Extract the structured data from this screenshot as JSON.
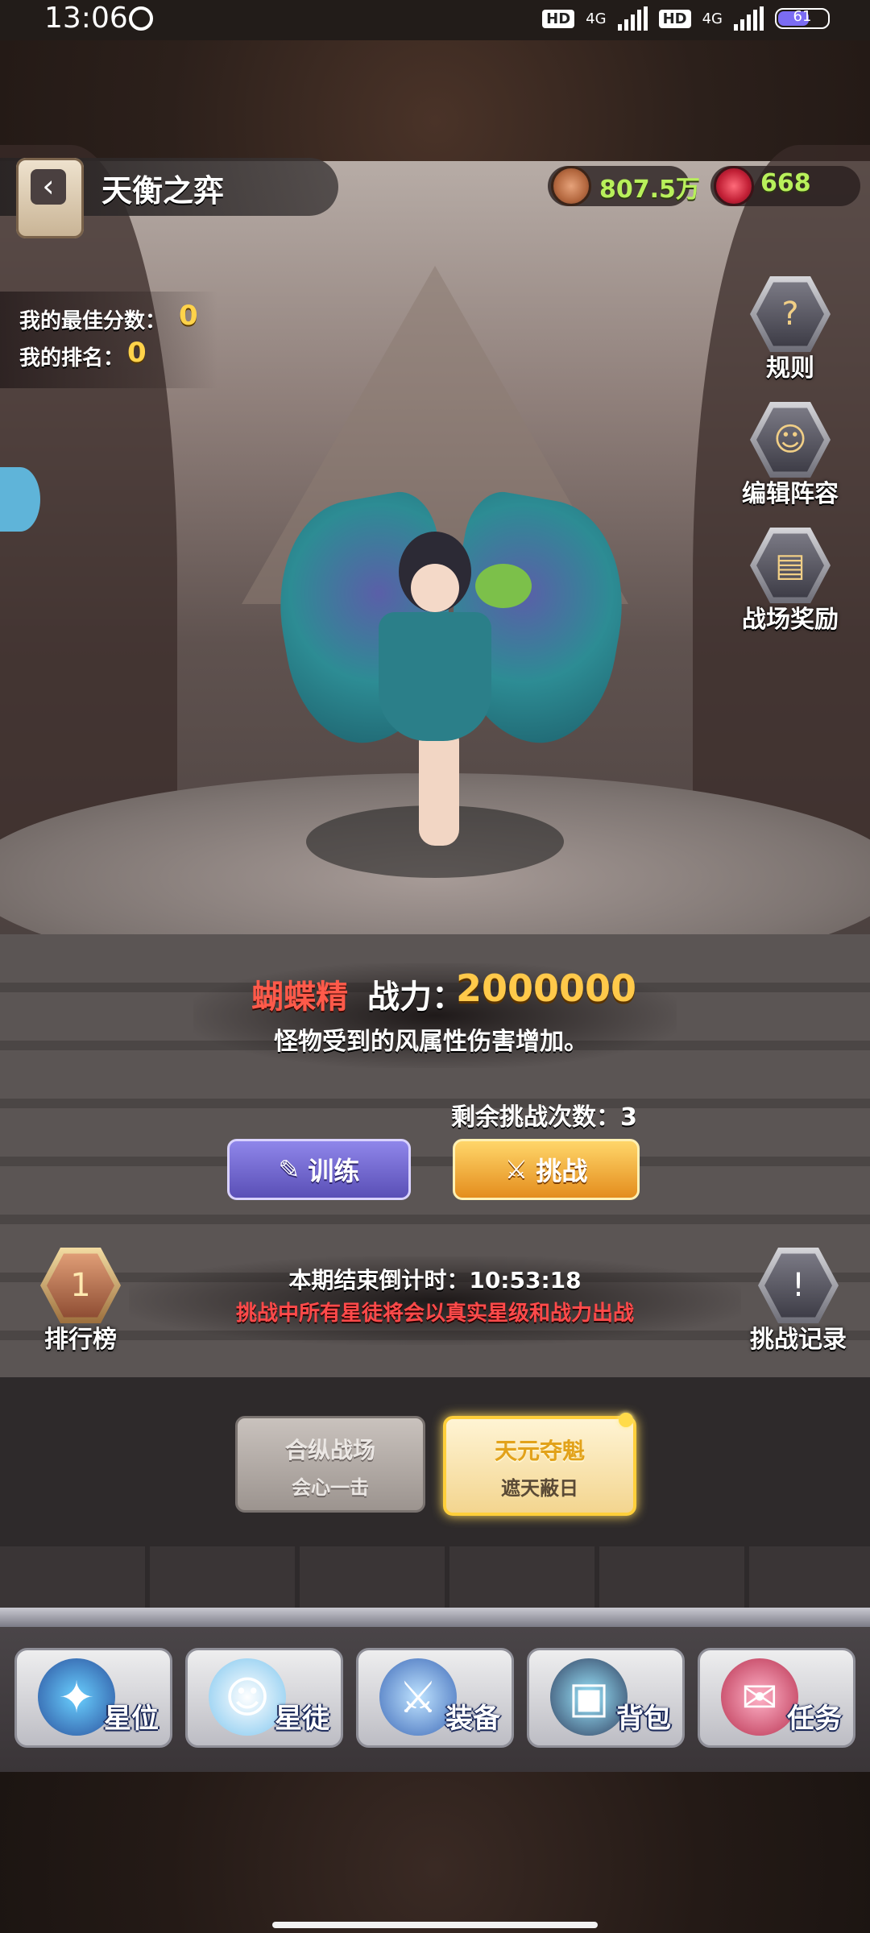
{
  "status_bar": {
    "time": "13:06",
    "net1": "HD",
    "net1_type": "4G",
    "net2": "HD",
    "net2_type": "4G",
    "battery": "61"
  },
  "header": {
    "title": "天衡之弈",
    "coins": "807.5万",
    "gems": "668"
  },
  "score": {
    "best_label": "我的最佳分数：",
    "best_value": "0",
    "rank_label": "我的排名：",
    "rank_value": "0"
  },
  "side_right": {
    "rules": "规则",
    "edit_lineup": "编辑阵容",
    "rewards": "战场奖励",
    "records": "挑战记录"
  },
  "side_left": {
    "leaderboard": "排行榜"
  },
  "boss": {
    "name": "蝴蝶精",
    "power_label": "战力：",
    "power_value": "2000000",
    "description": "怪物受到的风属性伤害增加。"
  },
  "challenge": {
    "remaining": "剩余挑战次数：3",
    "train_label": "训练",
    "fight_label": "挑战"
  },
  "countdown": {
    "text": "本期结束倒计时：10:53:18",
    "warning": "挑战中所有星徒将会以真实星级和战力出战"
  },
  "modes": [
    {
      "title": "合纵战场",
      "subtitle": "会心一击"
    },
    {
      "title": "天元夺魁",
      "subtitle": "遮天蔽日"
    }
  ],
  "nav": [
    "星位",
    "星徒",
    "装备",
    "背包",
    "任务"
  ],
  "colors": {
    "accent_gold": "#ffc94a",
    "resource_green": "#b8f05b",
    "warning_red": "#ff4a4a",
    "train_purple": "#6f64d0",
    "fight_orange": "#f0a02a"
  },
  "icons": {
    "back": "chevron-left-icon",
    "coin": "coin-icon",
    "gem": "gem-icon",
    "rules": "scroll-question-icon",
    "lineup": "people-icon",
    "rewards": "chest-icon",
    "records": "exclamation-icon",
    "leaderboard": "rank-one-icon"
  }
}
